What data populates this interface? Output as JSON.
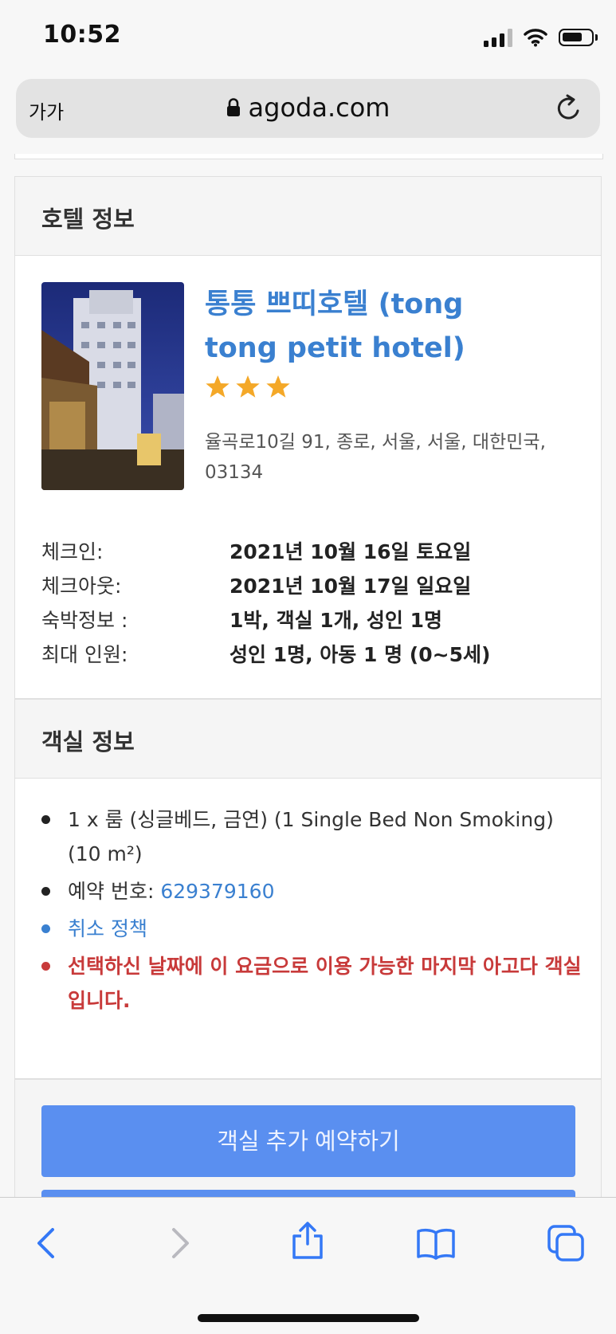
{
  "status_bar": {
    "time": "10:52"
  },
  "browser": {
    "text_size_label": "가가",
    "domain": "agoda.com"
  },
  "hotel_info": {
    "header": "호텔 정보",
    "name": "통통 쁘띠호텔 (tong tong petit hotel)",
    "stars": 3,
    "address": "율곡로10길 91, 종로, 서울, 서울, 대한민국, 03134",
    "rows": [
      {
        "label": "체크인:",
        "value": "2021년 10월 16일 토요일"
      },
      {
        "label": "체크아웃:",
        "value": "2021년 10월 17일 일요일"
      },
      {
        "label": "숙박정보 :",
        "value": "1박, 객실 1개, 성인 1명"
      },
      {
        "label": "최대 인원:",
        "value": "성인 1명, 아동 1 명 (0~5세)"
      }
    ]
  },
  "room_info": {
    "header": "객실 정보",
    "room_type": "1 x 룸 (싱글베드, 금연) (1 Single Bed Non Smoking) (10 m²)",
    "booking_label": "예약 번호: ",
    "booking_number": "629379160",
    "cancel_policy": "취소 정책",
    "last_room_notice": "선택하신 날짜에 이 요금으로 이용 가능한 마지막 아고다 객실입니다."
  },
  "actions": {
    "add_room_button": "객실 추가 예약하기"
  },
  "colors": {
    "link": "#3a80d0",
    "warning": "#c83a3a",
    "button": "#5a8ff0",
    "star": "#f4a828"
  }
}
